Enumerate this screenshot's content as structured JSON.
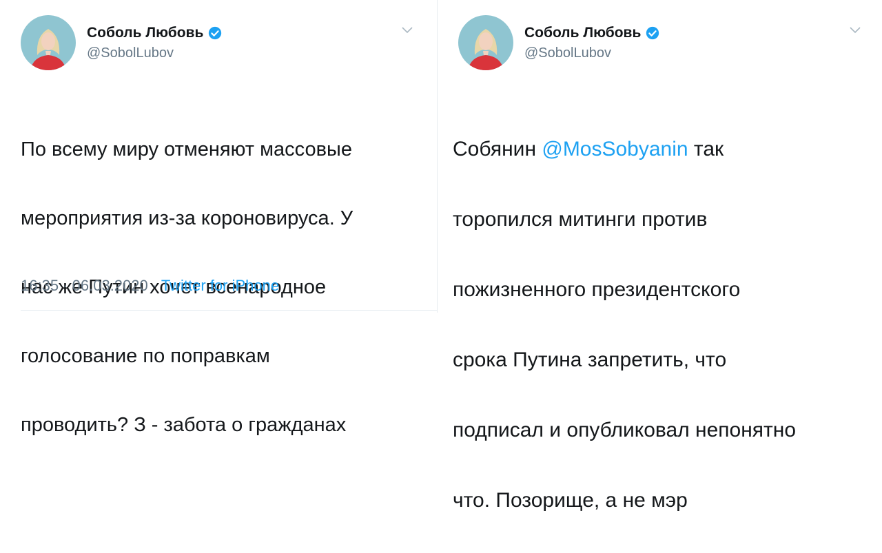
{
  "colors": {
    "accent": "#1da1f2",
    "text": "#14171a",
    "secondary": "#657786",
    "avatar_bg": "#8fc5d1",
    "shirt": "#d9343b"
  },
  "tweets": [
    {
      "author": {
        "name": "Соболь Любовь",
        "handle": "@SobolLubov",
        "verified_icon": "verified-badge-icon"
      },
      "text_lines": [
        "По всему миру отменяют массовые",
        "мероприятия из-за короновируса. У",
        "нас же Путин хочет всенародное",
        "голосование по поправкам",
        "проводить? З - забота о гражданах"
      ],
      "time": "16:35",
      "dot1": "·",
      "date": "06.03.2020",
      "dot2": "·",
      "source": "Twitter for iPhone"
    },
    {
      "author": {
        "name": "Соболь Любовь",
        "handle": "@SobolLubov",
        "verified_icon": "verified-badge-icon"
      },
      "text_prefix": "Собянин ",
      "mention": "@MosSobyanin",
      "text_suffix_first_line": " так",
      "text_lines_rest": [
        "торопился митинги против",
        "пожизненного президентского",
        "срока Путина запретить, что",
        "подписал и опубликовал непонятно",
        "что. Позорище, а не мэр"
      ]
    }
  ]
}
